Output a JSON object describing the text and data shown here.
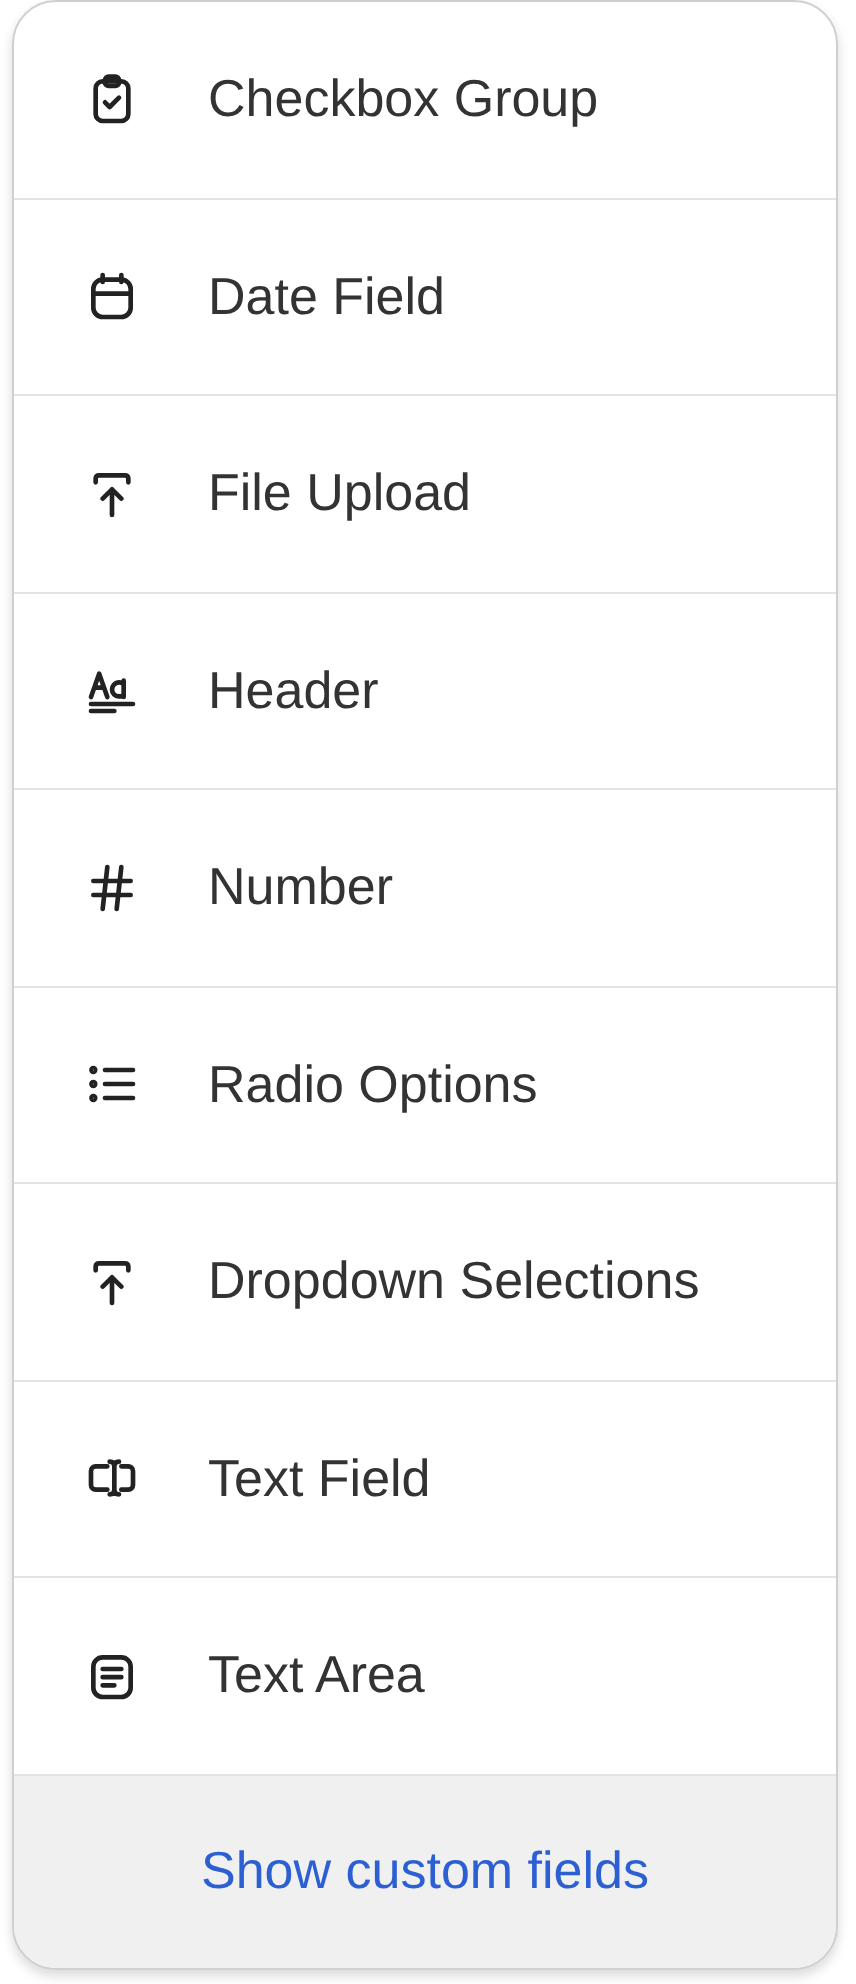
{
  "menu": {
    "items": [
      {
        "label": "Checkbox Group"
      },
      {
        "label": "Date Field"
      },
      {
        "label": "File Upload"
      },
      {
        "label": "Header"
      },
      {
        "label": "Number"
      },
      {
        "label": "Radio Options"
      },
      {
        "label": "Dropdown Selections"
      },
      {
        "label": "Text Field"
      },
      {
        "label": "Text Area"
      }
    ],
    "footer_link": "Show custom fields"
  }
}
